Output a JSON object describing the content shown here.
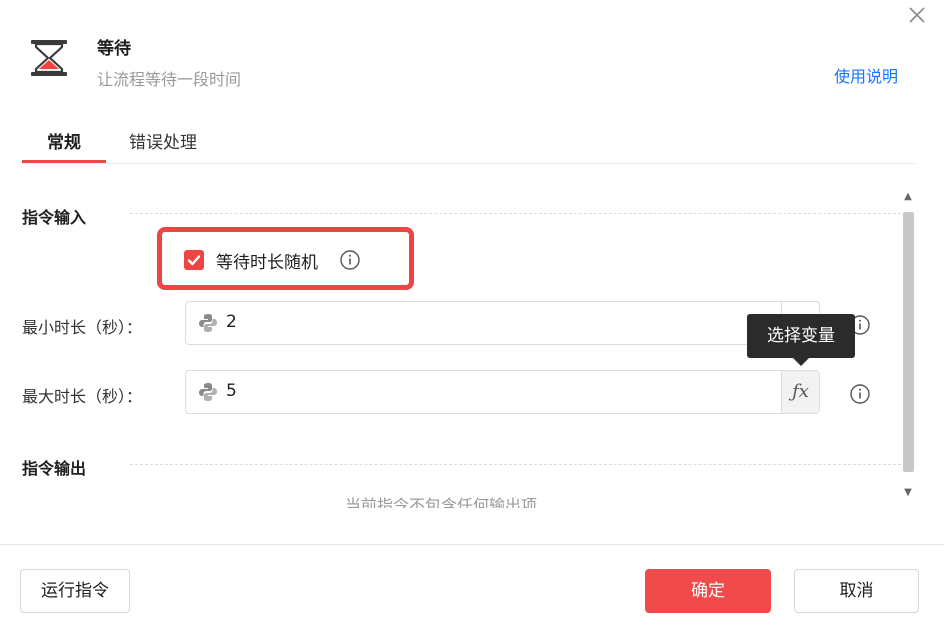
{
  "header": {
    "title": "等待",
    "subtitle": "让流程等待一段时间",
    "help_link": "使用说明",
    "icon": "hourglass-icon"
  },
  "tabs": [
    {
      "label": "常规",
      "active": true
    },
    {
      "label": "错误处理",
      "active": false
    }
  ],
  "sections": {
    "input_title": "指令输入",
    "output_title": "指令输出",
    "output_partial_text": "当前指令不包含任何输出项"
  },
  "random_toggle": {
    "label": "等待时长随机",
    "checked": true
  },
  "fields": [
    {
      "label": "最小时长（秒）：",
      "value": "2"
    },
    {
      "label": "最大时长（秒）：",
      "value": "5",
      "action": "ƒx"
    }
  ],
  "tooltip": "选择变量",
  "footer": {
    "run_label": "运行指令",
    "ok_label": "确定",
    "cancel_label": "取消"
  },
  "colors": {
    "accent": "#f04a4a",
    "link": "#1677ff",
    "tooltip_bg": "#2b2b2b"
  }
}
